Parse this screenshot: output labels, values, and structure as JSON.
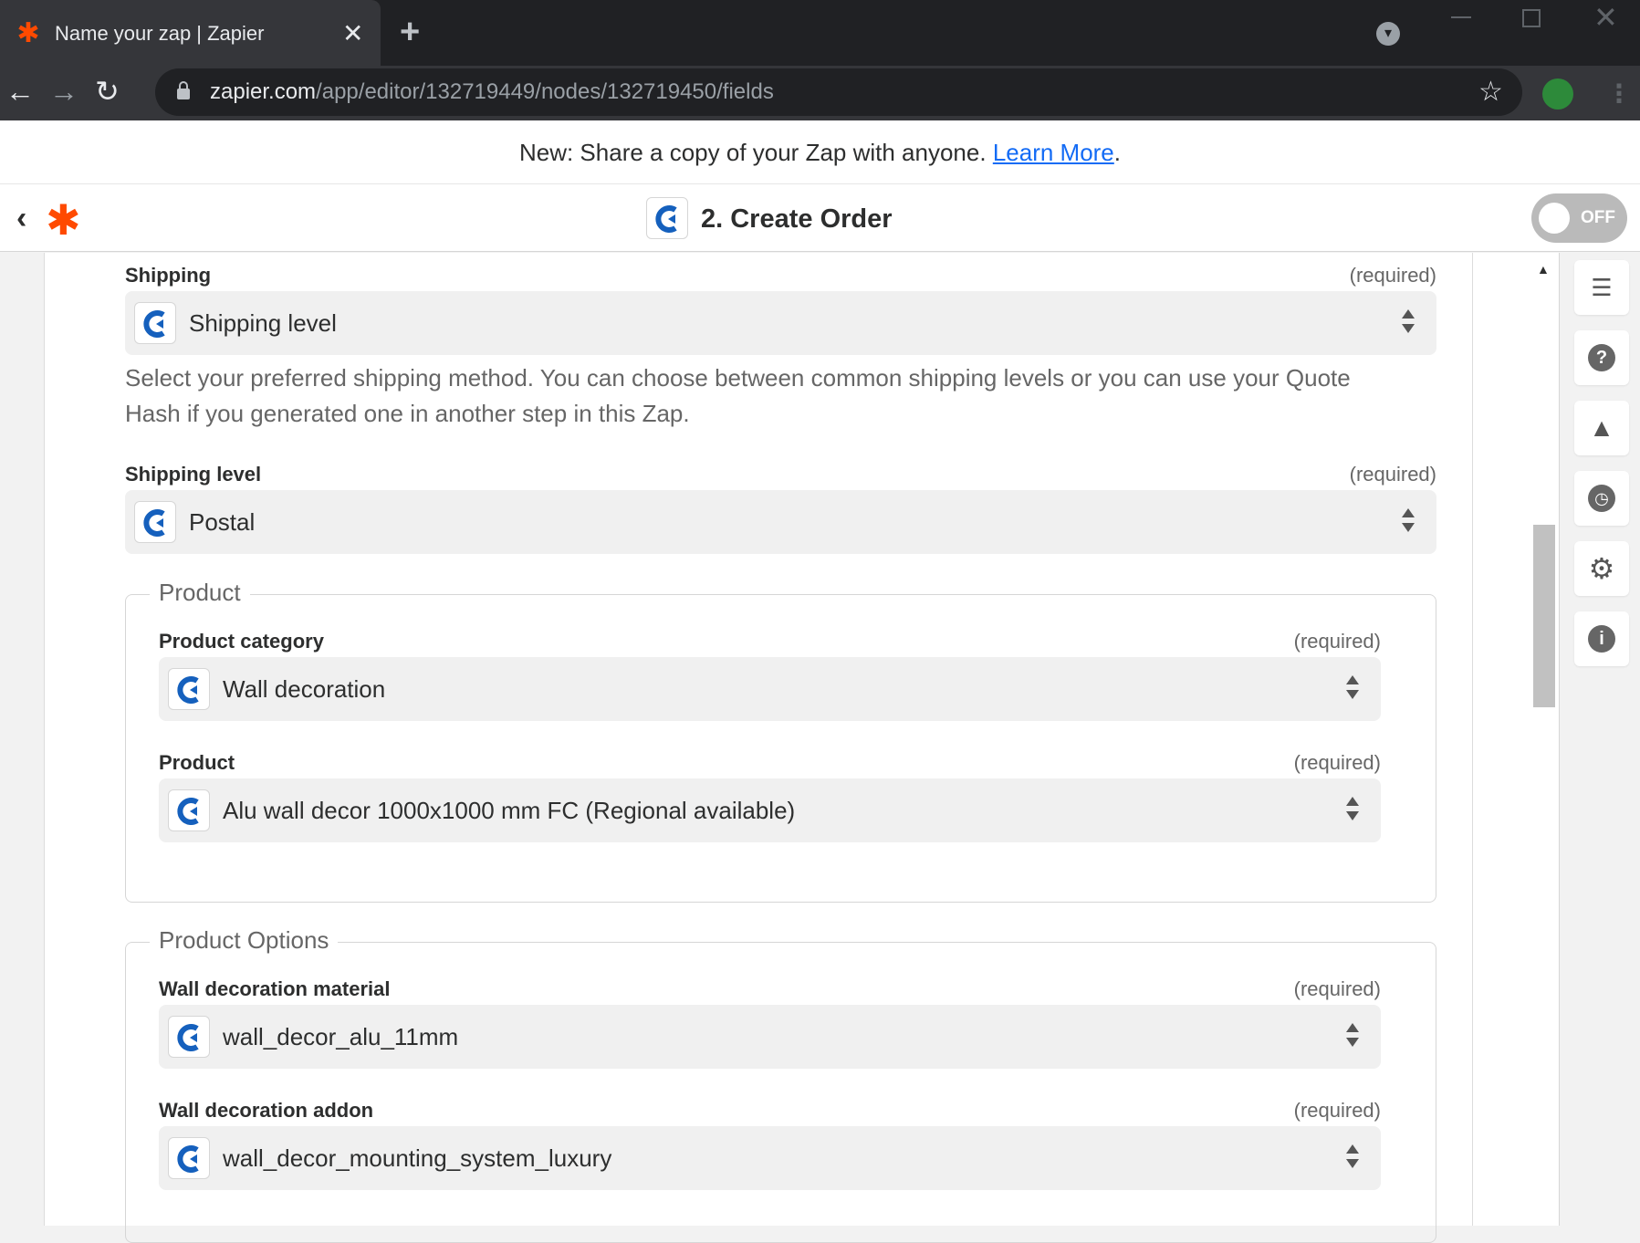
{
  "browser": {
    "tab_title": "Name your zap | Zapier",
    "url_host": "zapier.com",
    "url_path": "/app/editor/132719449/nodes/132719450/fields"
  },
  "banner": {
    "text": "New: Share a copy of your Zap with anyone. ",
    "link": "Learn More",
    "suffix": "."
  },
  "header": {
    "title": "2. Create Order",
    "toggle_label": "OFF"
  },
  "form": {
    "shipping": {
      "label": "Shipping",
      "required": "(required)",
      "value": "Shipping level",
      "help": "Select your preferred shipping method. You can choose between common shipping levels or you can use your Quote Hash if you generated one in another step in this Zap."
    },
    "shipping_level": {
      "label": "Shipping level",
      "required": "(required)",
      "value": "Postal"
    },
    "product_group": {
      "legend": "Product",
      "category": {
        "label": "Product category",
        "required": "(required)",
        "value": "Wall decoration"
      },
      "product": {
        "label": "Product",
        "required": "(required)",
        "value": "Alu wall decor 1000x1000 mm FC (Regional available)"
      }
    },
    "options_group": {
      "legend": "Product Options",
      "material": {
        "label": "Wall decoration material",
        "required": "(required)",
        "value": "wall_decor_alu_11mm"
      },
      "addon": {
        "label": "Wall decoration addon",
        "required": "(required)",
        "value": "wall_decor_mounting_system_luxury"
      }
    }
  },
  "side_rail": {
    "icons": [
      "outline-icon",
      "help-icon",
      "warning-icon",
      "history-icon",
      "settings-icon",
      "info-icon"
    ]
  },
  "colors": {
    "zapier_orange": "#ff4a00",
    "link_blue": "#136bf5",
    "capi_blue": "#1560bd"
  }
}
